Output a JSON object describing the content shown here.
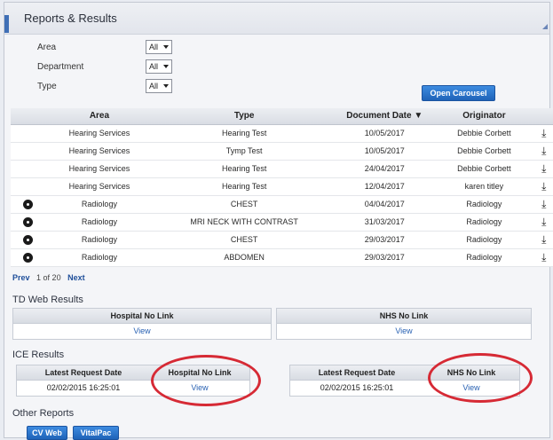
{
  "panel": {
    "title": "Reports & Results"
  },
  "filters": [
    {
      "label": "Area",
      "value": "All"
    },
    {
      "label": "Department",
      "value": "All"
    },
    {
      "label": "Type",
      "value": "All"
    }
  ],
  "buttons": {
    "open_carousel": "Open Carousel"
  },
  "table": {
    "headers": {
      "area": "Area",
      "type": "Type",
      "date": "Document Date ▼",
      "originator": "Originator"
    },
    "rows": [
      {
        "icon": "",
        "area": "Hearing Services",
        "type": "Hearing Test",
        "date": "10/05/2017",
        "originator": "Debbie Corbett"
      },
      {
        "icon": "",
        "area": "Hearing Services",
        "type": "Tymp Test",
        "date": "10/05/2017",
        "originator": "Debbie Corbett"
      },
      {
        "icon": "",
        "area": "Hearing Services",
        "type": "Hearing Test",
        "date": "24/04/2017",
        "originator": "Debbie Corbett"
      },
      {
        "icon": "",
        "area": "Hearing Services",
        "type": "Hearing Test",
        "date": "12/04/2017",
        "originator": "karen titley"
      },
      {
        "icon": "radiation-icon",
        "area": "Radiology",
        "type": "CHEST",
        "date": "04/04/2017",
        "originator": "Radiology"
      },
      {
        "icon": "radiation-icon",
        "area": "Radiology",
        "type": "MRI NECK WITH CONTRAST",
        "date": "31/03/2017",
        "originator": "Radiology"
      },
      {
        "icon": "radiation-icon",
        "area": "Radiology",
        "type": "CHEST",
        "date": "29/03/2017",
        "originator": "Radiology"
      },
      {
        "icon": "radiation-icon",
        "area": "Radiology",
        "type": "ABDOMEN",
        "date": "29/03/2017",
        "originator": "Radiology"
      }
    ]
  },
  "pager": {
    "prev": "Prev",
    "count": "1 of 20",
    "next": "Next"
  },
  "td_web": {
    "label": "TD Web Results",
    "hospital_header": "Hospital No Link",
    "hospital_link": "View",
    "nhs_header": "NHS No Link",
    "nhs_link": "View"
  },
  "ice": {
    "label": "ICE Results",
    "left": {
      "date_header": "Latest Request Date",
      "date_value": "02/02/2015 16:25:01",
      "link_header": "Hospital No Link",
      "link": "View"
    },
    "right": {
      "date_header": "Latest Request Date",
      "date_value": "02/02/2015 16:25:01",
      "link_header": "NHS No Link",
      "link": "View"
    }
  },
  "other": {
    "label": "Other Reports",
    "cv_web": "CV Web",
    "vitalpac": "VitalPac"
  },
  "colors": {
    "accent": "#3f6fb6",
    "button": "#1f63b8",
    "highlight_ring": "#d62a35"
  }
}
